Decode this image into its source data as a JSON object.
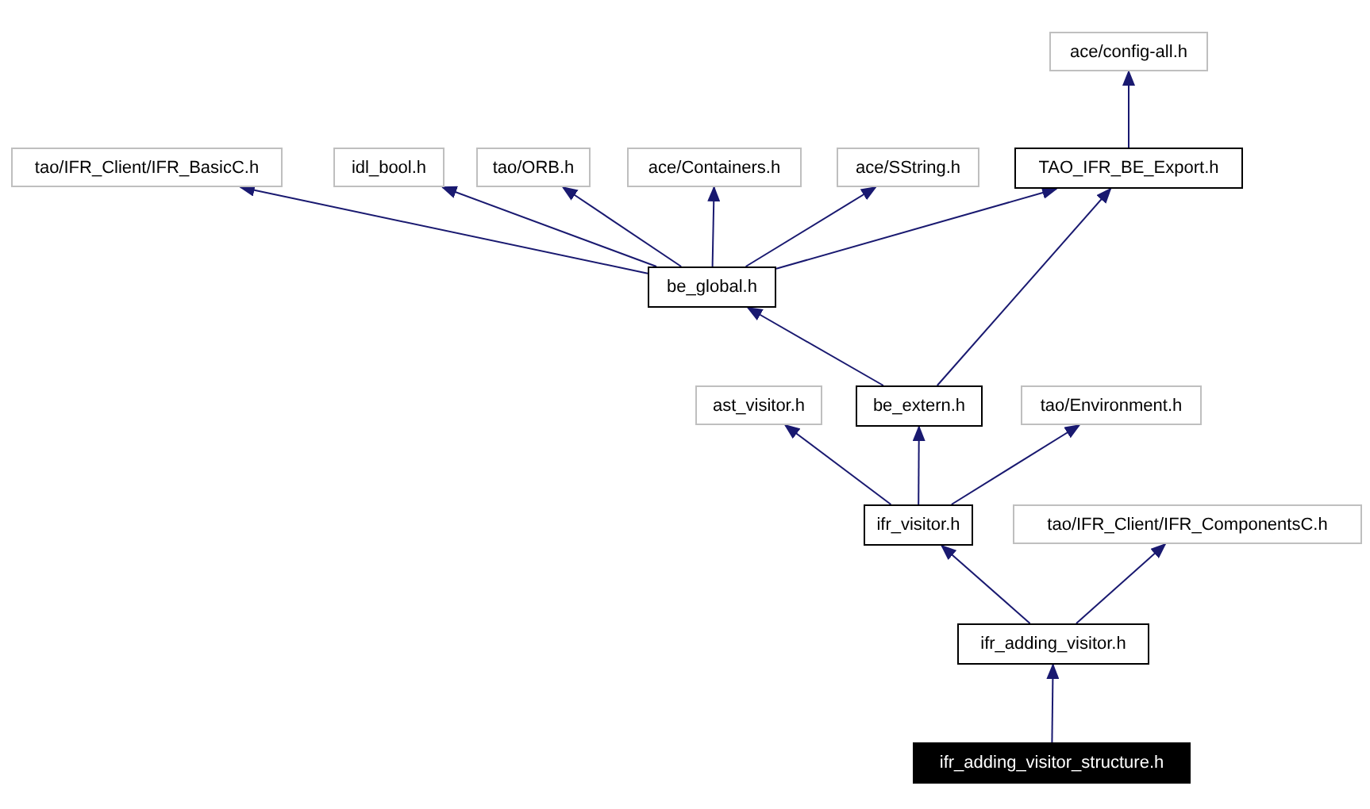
{
  "graph": {
    "nodes": [
      {
        "label": "ace/config-all.h",
        "kind": "external"
      },
      {
        "label": "tao/IFR_Client/IFR_BasicC.h",
        "kind": "external"
      },
      {
        "label": "idl_bool.h",
        "kind": "external"
      },
      {
        "label": "tao/ORB.h",
        "kind": "external"
      },
      {
        "label": "ace/Containers.h",
        "kind": "external"
      },
      {
        "label": "ace/SString.h",
        "kind": "external"
      },
      {
        "label": "TAO_IFR_BE_Export.h",
        "kind": "documented"
      },
      {
        "label": "be_global.h",
        "kind": "documented"
      },
      {
        "label": "ast_visitor.h",
        "kind": "external"
      },
      {
        "label": "be_extern.h",
        "kind": "documented"
      },
      {
        "label": "tao/Environment.h",
        "kind": "external"
      },
      {
        "label": "ifr_visitor.h",
        "kind": "documented"
      },
      {
        "label": "tao/IFR_Client/IFR_ComponentsC.h",
        "kind": "external"
      },
      {
        "label": "ifr_adding_visitor.h",
        "kind": "documented"
      },
      {
        "label": "ifr_adding_visitor_structure.h",
        "kind": "current"
      }
    ]
  }
}
